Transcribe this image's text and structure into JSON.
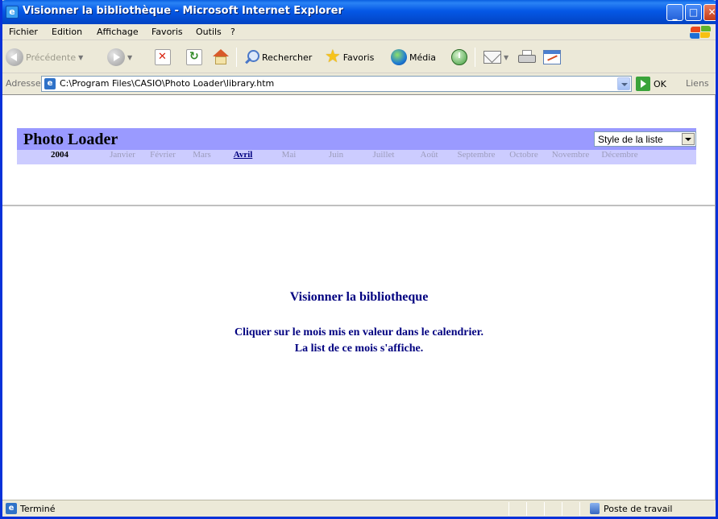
{
  "window": {
    "title": "Visionner la bibliothèque - Microsoft Internet Explorer",
    "title_icon": "ie-page-icon",
    "minimize_glyph": "_",
    "maximize_glyph": "□",
    "close_glyph": "✕"
  },
  "menu": {
    "items": [
      "Fichier",
      "Edition",
      "Affichage",
      "Favoris",
      "Outils",
      "?"
    ]
  },
  "toolbar": {
    "back_label": "Précédente",
    "search_label": "Rechercher",
    "favorites_label": "Favoris",
    "media_label": "Média"
  },
  "address": {
    "label": "Adresse",
    "url": "C:\\Program Files\\CASIO\\Photo Loader\\library.htm",
    "go_label": "OK",
    "links_label": "Liens"
  },
  "page": {
    "app_title": "Photo Loader",
    "style_select": "Style de la liste",
    "year": "2004",
    "months": [
      "Janvier",
      "Février",
      "Mars",
      "Avril",
      "Mai",
      "Juin",
      "Juillet",
      "Août",
      "Septembre",
      "Octobre",
      "Novembre",
      "Décembre"
    ],
    "active_month": "Avril",
    "message_title": "Visionner la bibliotheque",
    "message_line1": "Cliquer sur le mois mis en valeur dans le calendrier.",
    "message_line2": "La list de ce mois s'affiche."
  },
  "status": {
    "text": "Terminé",
    "zone": "Poste de travail"
  },
  "colors": {
    "header_bar": "#9a9aff",
    "month_row": "#ccccff",
    "message_text": "#000080"
  }
}
